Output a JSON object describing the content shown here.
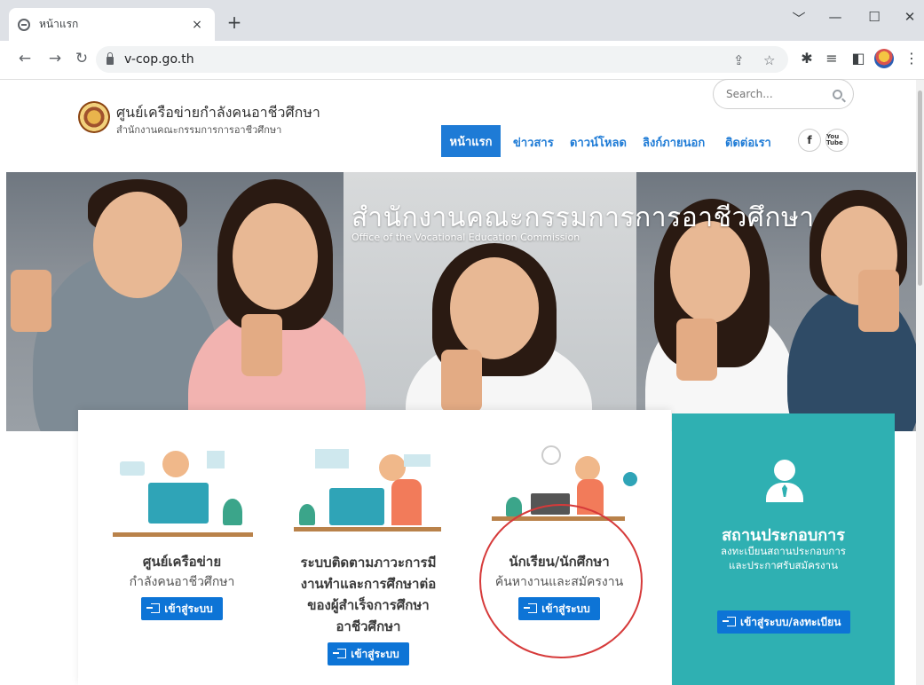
{
  "browser": {
    "tab_title": "หน้าแรก",
    "tab_close": "×",
    "new_tab": "+",
    "url": "v-cop.go.th",
    "window_controls": [
      "﹀",
      "—",
      "☐",
      "✕"
    ]
  },
  "site": {
    "title": "ศูนย์เครือข่ายกำลังคนอาชีวศึกษา",
    "subtitle": "สำนักงานคณะกรรมการการอาชีวศึกษา",
    "search_placeholder": "Search..."
  },
  "nav": {
    "items": [
      "หน้าแรก",
      "ข่าวสาร",
      "ดาวน์โหลด",
      "ลิงก์ภายนอก",
      "ติดต่อเรา"
    ],
    "active_index": 0,
    "social": [
      "f",
      "You Tube"
    ]
  },
  "banner": {
    "title": "สำนักงานคณะกรรมการการอาชีวศึกษา",
    "subtitle": "Office of the Vocational Education Commission"
  },
  "cards": [
    {
      "title": "ศูนย์เครือข่าย",
      "subtitle": "กำลังคนอาชีวศึกษา",
      "button": "เข้าสู่ระบบ"
    },
    {
      "title_lines": [
        "ระบบติดตามภาวะการมี",
        "งานทำและการศึกษาต่อ",
        "ของผู้สำเร็จการศึกษา",
        "อาชีวศึกษา"
      ],
      "button": "เข้าสู่ระบบ"
    },
    {
      "title": "นักเรียน/นักศึกษา",
      "subtitle": "ค้นหางานและสมัครงาน",
      "button": "เข้าสู่ระบบ"
    }
  ],
  "employer": {
    "title": "สถานประกอบการ",
    "line1": "ลงทะเบียนสถานประกอบการ",
    "line2": "และประกาศรับสมัครงาน",
    "button": "เข้าสู่ระบบ/ลงทะเบียน"
  },
  "colors": {
    "primary": "#0d74d6",
    "nav_blue": "#1e7bd6",
    "teal": "#2fb0b2",
    "highlight_circle": "#d63a3a"
  }
}
